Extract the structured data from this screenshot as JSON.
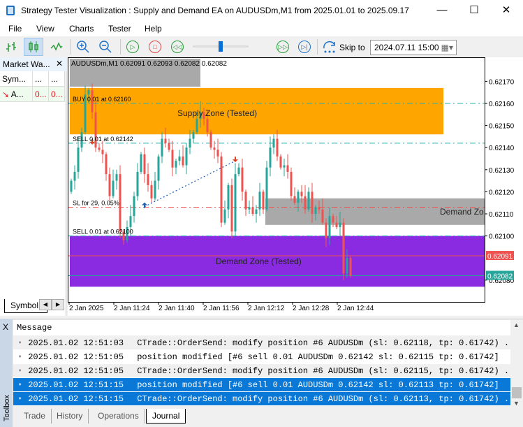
{
  "window": {
    "title": "Strategy Tester Visualization : Supply and Demand EA on AUDUSDm,M1 from 2025.01.01 to 2025.09.17",
    "minimize": "—",
    "maximize": "☐",
    "close": "✕"
  },
  "menu": [
    "File",
    "View",
    "Charts",
    "Tester",
    "Help"
  ],
  "toolbar": {
    "skip_label": "Skip to",
    "skip_date": "2024.07.11 15:00",
    "slider_position": 0.48
  },
  "market_watch": {
    "title": "Market Wa...",
    "close": "✕",
    "columns": [
      "Sym...",
      "...",
      "..."
    ],
    "rows": [
      {
        "arrow": "↘",
        "symbol": "A...",
        "bid": "0...",
        "ask": "0..."
      }
    ],
    "tab": "Symbol",
    "colors": {
      "down": "#e81123"
    }
  },
  "chart": {
    "header": "AUDUSDm,M1  0.62091 0.62093 0.62082 0.62082",
    "supply_label": "Supply Zone (Tested)",
    "demand_label": "Demand Zone (Tested)",
    "demand_label2": "Demand Zo",
    "order_labels": {
      "buy": "BUY 0.01 at 0.62160",
      "sell1": "SELL 0.01 at 0.62142",
      "sl": "SL for 29, 0.05%",
      "sell2": "SELL 0.01 at 0.62100"
    },
    "bid_tag": "0.62091",
    "ask_tag": "0.62082",
    "colors": {
      "bull": "#26a69a",
      "bear": "#ef5350",
      "supply": "#ffa500",
      "demand": "#8a2be2",
      "zone_gray": "#a9a9a9"
    }
  },
  "chart_data": {
    "type": "candlestick",
    "symbol": "AUDUSDm",
    "timeframe": "M1",
    "ylim": [
      0.62058,
      0.62178
    ],
    "price_ticks": [
      "0.62170",
      "0.62160",
      "0.62150",
      "0.62140",
      "0.62130",
      "0.62120",
      "0.62110",
      "0.62100",
      "0.62080"
    ],
    "price_tick_values": [
      0.6217,
      0.6216,
      0.6215,
      0.6214,
      0.6213,
      0.6212,
      0.6211,
      0.621,
      0.6208
    ],
    "time_ticks": [
      "2 Jan 2025",
      "2 Jan 11:24",
      "2 Jan 11:40",
      "2 Jan 11:56",
      "2 Jan 12:12",
      "2 Jan 12:28",
      "2 Jan 12:44"
    ],
    "first_open": 0.6212,
    "closes": [
      0.62125,
      0.62129,
      0.6214,
      0.62147,
      0.62164,
      0.62166,
      0.62156,
      0.6214,
      0.62139,
      0.62137,
      0.62128,
      0.62118,
      0.62125,
      0.62128,
      0.62102,
      0.62098,
      0.62104,
      0.62109,
      0.62118,
      0.62129,
      0.62137,
      0.62128,
      0.62123,
      0.62117,
      0.62125,
      0.62136,
      0.62144,
      0.62142,
      0.62139,
      0.62131,
      0.62134,
      0.62136,
      0.62132,
      0.6214,
      0.62144,
      0.62147,
      0.62153,
      0.62156,
      0.62153,
      0.62147,
      0.6214,
      0.62139,
      0.62136,
      0.62106,
      0.62112,
      0.62123,
      0.62102,
      0.62128,
      0.62131,
      0.6212,
      0.62112,
      0.62113,
      0.6211,
      0.62112,
      0.6212,
      0.62112,
      0.62131,
      0.6214,
      0.62144,
      0.62136,
      0.62131,
      0.62132,
      0.62129,
      0.62118,
      0.62115,
      0.6212,
      0.62118,
      0.62112,
      0.6212,
      0.6211,
      0.62113,
      0.62112,
      0.62106,
      0.62099,
      0.62109,
      0.62106,
      0.62104,
      0.62106,
      0.62083,
      0.6209,
      0.62082
    ],
    "zones": [
      {
        "name": "supply",
        "from": 0.62146,
        "to": 0.62167,
        "start": 0,
        "end": 107
      },
      {
        "name": "demand-gray",
        "from": 0.62105,
        "to": 0.62117,
        "start": 56,
        "end": 120
      },
      {
        "name": "demand",
        "from": 0.62077,
        "to": 0.621,
        "start": 0,
        "end": 120
      }
    ],
    "levels": [
      {
        "name": "buy",
        "price": 0.6216,
        "color": "#20b2aa"
      },
      {
        "name": "sell1",
        "price": 0.62142,
        "color": "#20b2aa"
      },
      {
        "name": "sl",
        "price": 0.62113,
        "color": "#ef5350"
      },
      {
        "name": "sell2",
        "price": 0.621,
        "color": "#20b2aa"
      },
      {
        "name": "bid",
        "price": 0.62091,
        "color": "#ef5350"
      },
      {
        "name": "ask",
        "price": 0.62082,
        "color": "#26a69a"
      }
    ],
    "markers": [
      {
        "type": "sell",
        "index": 6,
        "price": 0.62142
      },
      {
        "type": "buy",
        "index": 21,
        "price": 0.62112
      },
      {
        "type": "sell",
        "index": 47,
        "price": 0.62134
      }
    ]
  },
  "toolbox": {
    "title": "Toolbox",
    "close": "X",
    "header": "Message",
    "rows": [
      {
        "time": "2025.01.02 12:51:03",
        "msg": "CTrade::OrderSend: modify position #6 AUDUSDm (sl: 0.62118, tp: 0.61742) ...",
        "selected": false
      },
      {
        "time": "2025.01.02 12:51:05",
        "msg": "position modified [#6 sell 0.01 AUDUSDm 0.62142 sl: 0.62115 tp: 0.61742]",
        "selected": false
      },
      {
        "time": "2025.01.02 12:51:05",
        "msg": "CTrade::OrderSend: modify position #6 AUDUSDm (sl: 0.62115, tp: 0.61742) ...",
        "selected": false
      },
      {
        "time": "2025.01.02 12:51:15",
        "msg": "position modified [#6 sell 0.01 AUDUSDm 0.62142 sl: 0.62113 tp: 0.61742]",
        "selected": true
      },
      {
        "time": "2025.01.02 12:51:15",
        "msg": "CTrade::OrderSend: modify position #6 AUDUSDm (sl: 0.62113, tp: 0.61742) ...",
        "selected": true
      }
    ],
    "tabs": [
      "Trade",
      "History",
      "Operations",
      "Journal"
    ],
    "active_tab": "Journal"
  }
}
